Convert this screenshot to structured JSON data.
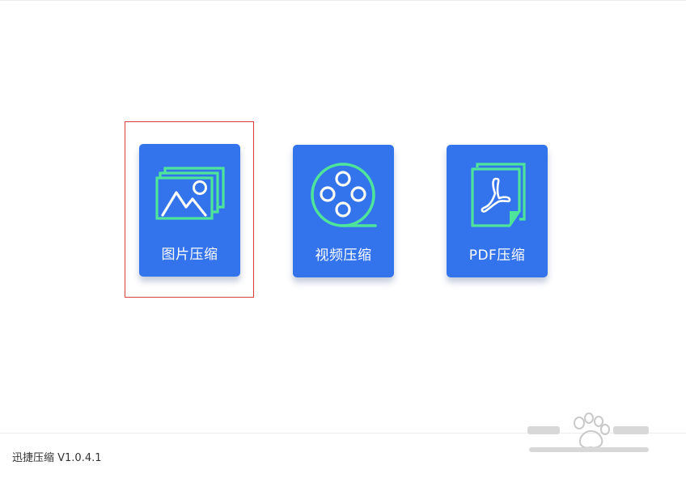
{
  "cards": [
    {
      "label": "图片压缩",
      "icon": "image-compress-icon"
    },
    {
      "label": "视频压缩",
      "icon": "video-reel-icon"
    },
    {
      "label": "PDF压缩",
      "icon": "pdf-file-icon"
    }
  ],
  "footer": {
    "version": "迅捷压缩 V1.0.4.1"
  },
  "colors": {
    "card_bg": "#3373ec",
    "icon_accent": "#4ee59a",
    "icon_white": "#ffffff",
    "highlight": "#d84040"
  }
}
